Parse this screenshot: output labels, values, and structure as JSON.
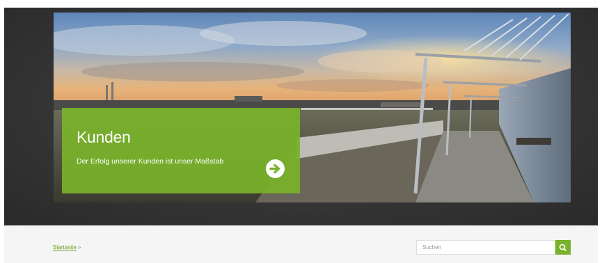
{
  "hero": {
    "title": "Kunden",
    "subtitle": "Der Erfolg unserer Kunden ist unser Maßstab",
    "arrow_icon": "arrow-right-circle-icon",
    "accent_color": "#78b22a"
  },
  "breadcrumb": {
    "home_label": "Startseite",
    "separator": "»"
  },
  "search": {
    "placeholder": "Suchen",
    "button_icon": "search-icon"
  }
}
